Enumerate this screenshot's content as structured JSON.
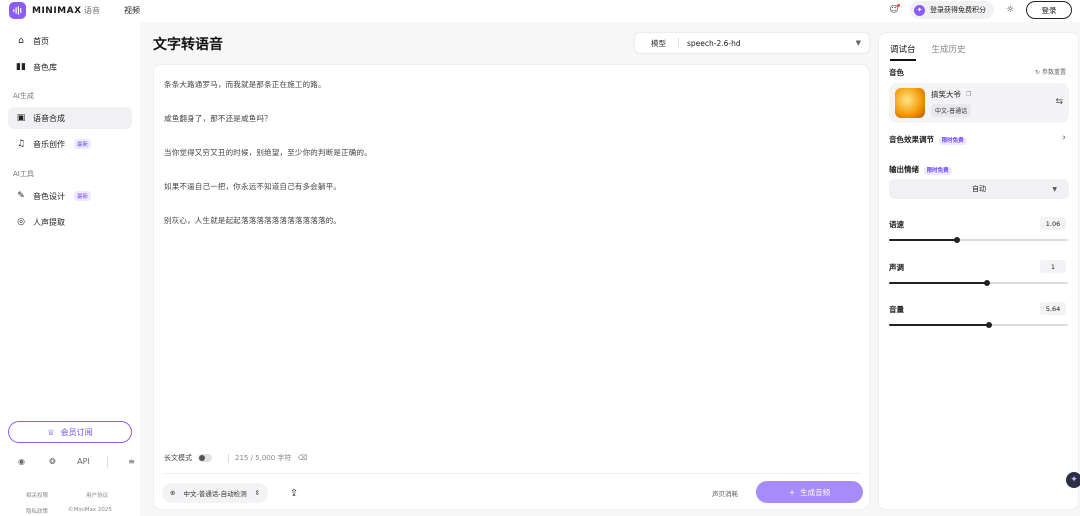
{
  "brand": {
    "name": "MINIMAX",
    "accent": "#8b5cf6"
  },
  "top_nav": {
    "tab_speech": "语音",
    "tab_video": "视频"
  },
  "header_right": {
    "promo": "登录获得免费积分",
    "login": "登录",
    "icons": [
      "robot-icon",
      "sparkle-icon",
      "sun-icon"
    ]
  },
  "sidebar": {
    "home": "首页",
    "voice_library": "音色库",
    "section_gen": "AI生成",
    "speech_synthesis": "语音合成",
    "music_creation": "音乐创作",
    "section_tools": "AI工具",
    "voice_design": "音色设计",
    "voice_extract": "人声提取",
    "badge_new": "最新",
    "vip": "会员订阅",
    "api": "API",
    "footer": {
      "link1": "相关权限",
      "link2": "用户协议",
      "link3": "隐私政策",
      "copyright": "©MiniMax 2025"
    }
  },
  "main": {
    "title": "文字转语音",
    "model_label": "模型",
    "model_value": "speech-2.6-hd",
    "paragraphs": [
      "条条大路通罗马，而我就是那条正在施工的路。",
      "咸鱼翻身了，那不还是咸鱼吗？",
      "当你觉得又穷又丑的时候，别绝望，至少你的判断是正确的。",
      "如果不逼自己一把，你永远不知道自己有多会躺平。",
      "别灰心，人生就是起起落落落落落落落落落落落的。"
    ],
    "long_text_mode": "长文模式",
    "char_count": "215 / 5,000 字符",
    "language": "中文-普通话-自动检测",
    "sound_effect": "声贝消耗",
    "generate": "生成音频"
  },
  "panel": {
    "tab_debug": "调试台",
    "tab_history": "生成历史",
    "voice_label": "音色",
    "reset": "参数重置",
    "voice_name": "搞笑大爷",
    "voice_tag": "中文-普通话",
    "effect_label": "音色效果调节",
    "badge_realtime": "限时免费",
    "emotion_label": "输出情绪",
    "emotion_value": "自动",
    "speed_label": "语速",
    "speed_value": "1.06",
    "pitch_label": "声调",
    "pitch_value": "1",
    "volume_label": "音量",
    "volume_value": "5.64",
    "speed_fraction": 0.38,
    "pitch_fraction": 0.55,
    "volume_fraction": 0.56
  }
}
